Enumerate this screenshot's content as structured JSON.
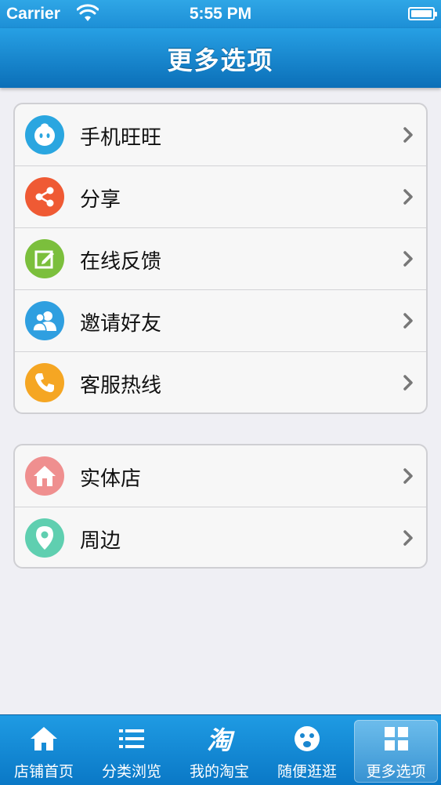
{
  "status_bar": {
    "carrier": "Carrier",
    "time": "5:55 PM"
  },
  "nav": {
    "title": "更多选项"
  },
  "group1": [
    {
      "label": "手机旺旺",
      "icon": "wangwang-icon",
      "color": "#2aa6e0"
    },
    {
      "label": "分享",
      "icon": "share-icon",
      "color": "#ef5a34"
    },
    {
      "label": "在线反馈",
      "icon": "feedback-edit-icon",
      "color": "#7bbf3c"
    },
    {
      "label": "邀请好友",
      "icon": "invite-friends-icon",
      "color": "#2f9fe0"
    },
    {
      "label": "客服热线",
      "icon": "phone-icon",
      "color": "#f5a623"
    }
  ],
  "group2": [
    {
      "label": "实体店",
      "icon": "store-home-icon",
      "color": "#ef8f8f"
    },
    {
      "label": "周边",
      "icon": "location-pin-icon",
      "color": "#5fcfb0"
    }
  ],
  "tabs": [
    {
      "label": "店铺首页",
      "icon": "home-icon"
    },
    {
      "label": "分类浏览",
      "icon": "list-icon"
    },
    {
      "label": "我的淘宝",
      "icon": "taobao-icon",
      "glyph": "淘"
    },
    {
      "label": "随便逛逛",
      "icon": "face-icon"
    },
    {
      "label": "更多选项",
      "icon": "grid-icon",
      "active": true
    }
  ]
}
